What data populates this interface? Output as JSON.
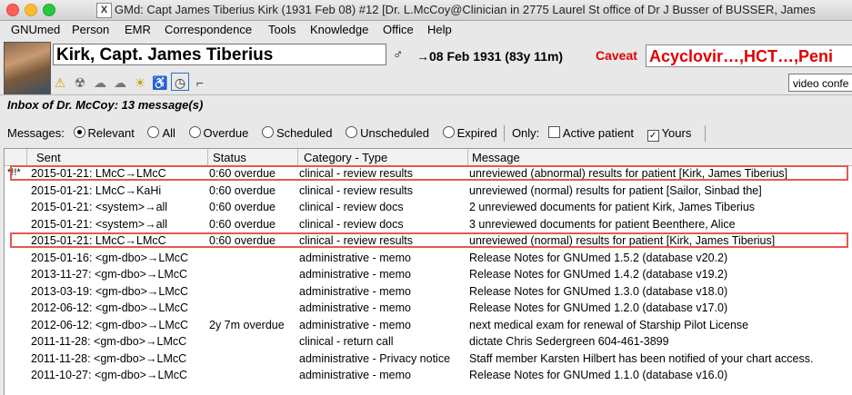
{
  "window": {
    "title": "GMd: Capt James Tiberius Kirk (1931 Feb 08) #12 [Dr. L.McCoy@Clinician in 2775 Laurel St office of Dr J Busser of BUSSER, James"
  },
  "menu": [
    "GNUmed",
    "Person",
    "EMR",
    "Correspondence",
    "Tools",
    "Knowledge",
    "Office",
    "Help"
  ],
  "patient": {
    "name": "Kirk, Capt. James Tiberius",
    "gender_symbol": "♂",
    "dob": "→08 Feb 1931 (83y 11m)",
    "caveat_label": "Caveat",
    "caveat_value": "Acyclovir…,HCT…,Peni"
  },
  "toolbar_icons": [
    "warning-icon",
    "allergy-icon",
    "smoking-icon",
    "cloud-icon",
    "weather-icon",
    "wheelchair-icon",
    "clock-icon",
    "pipe-icon"
  ],
  "video_button": "video confe",
  "inbox": {
    "title": "Inbox of Dr. McCoy: 13 message(s)"
  },
  "filters": {
    "messages_label": "Messages:",
    "options": [
      {
        "label": "Relevant",
        "selected": true
      },
      {
        "label": "All",
        "selected": false
      },
      {
        "label": "Overdue",
        "selected": false
      },
      {
        "label": "Scheduled",
        "selected": false
      },
      {
        "label": "Unscheduled",
        "selected": false
      },
      {
        "label": "Expired",
        "selected": false
      }
    ],
    "only_label": "Only:",
    "active_patient": {
      "label": "Active patient",
      "checked": false
    },
    "yours": {
      "label": "Yours",
      "checked": true
    }
  },
  "table": {
    "columns": [
      "Sent",
      "Status",
      "Category - Type",
      "Message"
    ],
    "rows": [
      {
        "flag": "*!!*",
        "sent": "2015-01-21: LMcC→LMcC",
        "status": "0:60 overdue",
        "category": "clinical - review results",
        "message": "unreviewed (abnormal) results for patient [Kirk, James Tiberius]",
        "highlight": true
      },
      {
        "flag": "",
        "sent": "2015-01-21: LMcC→KaHi",
        "status": "0:60 overdue",
        "category": "clinical - review results",
        "message": "unreviewed (normal) results for patient [Sailor, Sinbad the]",
        "highlight": false
      },
      {
        "flag": "",
        "sent": "2015-01-21: <system>→all",
        "status": "0:60 overdue",
        "category": "clinical - review docs",
        "message": "2 unreviewed documents for patient Kirk, James Tiberius",
        "highlight": false
      },
      {
        "flag": "",
        "sent": "2015-01-21: <system>→all",
        "status": "0:60 overdue",
        "category": "clinical - review docs",
        "message": "3 unreviewed documents for patient Beenthere, Alice",
        "highlight": false
      },
      {
        "flag": "",
        "sent": "2015-01-21: LMcC→LMcC",
        "status": "0:60 overdue",
        "category": "clinical - review results",
        "message": "unreviewed (normal) results for patient [Kirk, James Tiberius]",
        "highlight": true
      },
      {
        "flag": "",
        "sent": "2015-01-16: <gm-dbo>→LMcC",
        "status": "",
        "category": "administrative - memo",
        "message": "Release Notes for GNUmed 1.5.2 (database v20.2)",
        "highlight": false
      },
      {
        "flag": "",
        "sent": "2013-11-27: <gm-dbo>→LMcC",
        "status": "",
        "category": "administrative - memo",
        "message": "Release Notes for GNUmed 1.4.2 (database v19.2)",
        "highlight": false
      },
      {
        "flag": "",
        "sent": "2013-03-19: <gm-dbo>→LMcC",
        "status": "",
        "category": "administrative - memo",
        "message": "Release Notes for GNUmed 1.3.0 (database v18.0)",
        "highlight": false
      },
      {
        "flag": "",
        "sent": "2012-06-12: <gm-dbo>→LMcC",
        "status": "",
        "category": "administrative - memo",
        "message": "Release Notes for GNUmed 1.2.0 (database v17.0)",
        "highlight": false
      },
      {
        "flag": "",
        "sent": "2012-06-12: <gm-dbo>→LMcC",
        "status": "2y 7m overdue",
        "category": "administrative - memo",
        "message": "next medical exam for renewal of Starship Pilot License",
        "highlight": false
      },
      {
        "flag": "",
        "sent": "2011-11-28: <gm-dbo>→LMcC",
        "status": "",
        "category": "clinical - return call",
        "message": "dictate Chris Sedergreen 604-461-3899",
        "highlight": false
      },
      {
        "flag": "",
        "sent": "2011-11-28: <gm-dbo>→LMcC",
        "status": "",
        "category": "administrative - Privacy notice",
        "message": "Staff member Karsten Hilbert has been notified of your chart access.",
        "highlight": false
      },
      {
        "flag": "",
        "sent": "2011-10-27: <gm-dbo>→LMcC",
        "status": "",
        "category": "administrative - memo",
        "message": "Release Notes for GNUmed 1.1.0 (database v16.0)",
        "highlight": false
      }
    ]
  }
}
